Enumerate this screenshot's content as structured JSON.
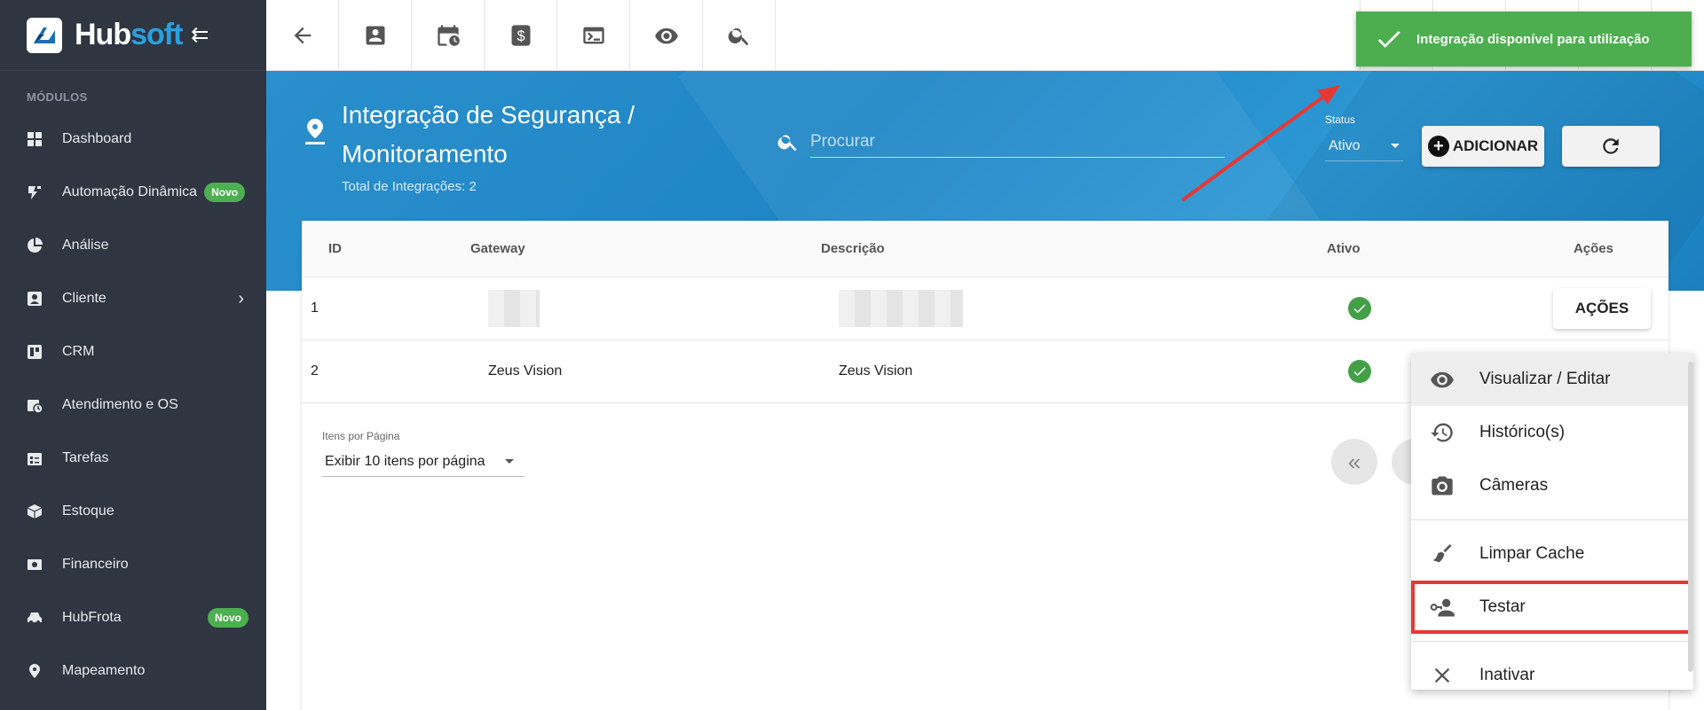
{
  "brand": {
    "name_part1": "Hub",
    "name_part2": "soft"
  },
  "sidebar": {
    "section_label": "MÓDULOS",
    "items": [
      {
        "label": "Dashboard",
        "icon": "dashboard-icon"
      },
      {
        "label": "Automação Dinâmica",
        "icon": "automation-icon",
        "badge": "Novo"
      },
      {
        "label": "Análise",
        "icon": "pie-chart-icon"
      },
      {
        "label": "Cliente",
        "icon": "client-card-icon",
        "has_submenu": true
      },
      {
        "label": "CRM",
        "icon": "crm-board-icon"
      },
      {
        "label": "Atendimento e OS",
        "icon": "calendar-clock-icon"
      },
      {
        "label": "Tarefas",
        "icon": "tasks-icon"
      },
      {
        "label": "Estoque",
        "icon": "box-icon"
      },
      {
        "label": "Financeiro",
        "icon": "money-icon"
      },
      {
        "label": "HubFrota",
        "icon": "car-icon",
        "badge": "Novo"
      },
      {
        "label": "Mapeamento",
        "icon": "map-pin-icon"
      }
    ]
  },
  "toast": {
    "message": "Integração disponível para utilização",
    "color": "#4cae4f"
  },
  "header": {
    "title": "Integração de Segurança / Monitoramento",
    "subtitle": "Total de Integrações: 2",
    "search_placeholder": "Procurar",
    "status_label": "Status",
    "status_value": "Ativo",
    "add_button_label": "ADICIONAR"
  },
  "table": {
    "columns": [
      "ID",
      "Gateway",
      "Descrição",
      "Ativo",
      "Ações"
    ],
    "rows": [
      {
        "id": "1",
        "gateway": "",
        "descricao": "",
        "ativo": true,
        "action_label": "AÇÕES"
      },
      {
        "id": "2",
        "gateway": "Zeus Vision",
        "descricao": "Zeus Vision",
        "ativo": true
      }
    ],
    "pager_label": "Itens por Página",
    "pager_value": "Exibir 10 itens por página"
  },
  "menu": {
    "items": [
      {
        "label": "Visualizar / Editar",
        "icon": "eye-icon"
      },
      {
        "label": "Histórico(s)",
        "icon": "history-icon"
      },
      {
        "label": "Câmeras",
        "icon": "camera-icon"
      },
      {
        "label": "Limpar Cache",
        "icon": "broom-icon"
      },
      {
        "label": "Testar",
        "icon": "key-person-icon"
      },
      {
        "label": "Inativar",
        "icon": "close-icon"
      }
    ]
  },
  "colors": {
    "sidebar_bg": "#2f3541",
    "banner": "#2a8fcc",
    "success": "#43a047",
    "highlight": "#e53935"
  }
}
